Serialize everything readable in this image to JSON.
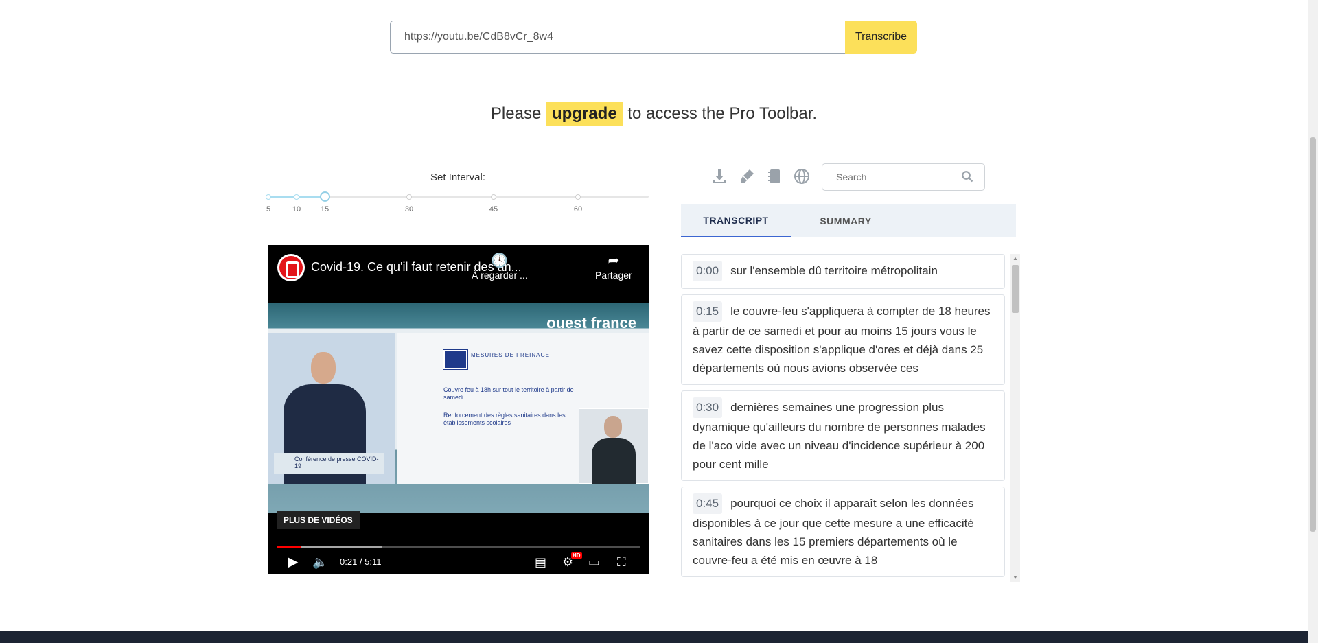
{
  "url_bar": {
    "value": "https://youtu.be/CdB8vCr_8w4",
    "button_label": "Transcribe"
  },
  "upgrade": {
    "before": "Please",
    "link": "upgrade",
    "after": "to access the Pro Toolbar."
  },
  "interval": {
    "label": "Set Interval:",
    "ticks": [
      "5",
      "10",
      "15",
      "30",
      "45",
      "60"
    ],
    "selected": 15
  },
  "video": {
    "title": "Covid-19. Ce qu'il faut retenir des an...",
    "watch_later_label": "À regarder ...",
    "share_label": "Partager",
    "brand_text": "ouest france",
    "podium_text": "Conférence de presse COVID-19",
    "slide_heading": "MESURES DE FREINAGE",
    "slide_bullet_1": "Couvre feu à 18h sur tout le territoire à partir de samedi",
    "slide_bullet_2": "Renforcement des règles sanitaires dans les établissements scolaires",
    "more_videos": "PLUS DE VIDÉOS",
    "current_time": "0:21",
    "duration": "5:11",
    "time_display": "0:21 / 5:11",
    "progress_played": 0.067,
    "progress_buffered": 0.29,
    "hd_badge": "HD"
  },
  "toolbar": {
    "icons": [
      "download-icon",
      "highlighter-icon",
      "notebook-icon",
      "globe-icon"
    ],
    "search_placeholder": "Search"
  },
  "tabs": [
    {
      "label": "TRANSCRIPT",
      "active": true
    },
    {
      "label": "SUMMARY",
      "active": false
    }
  ],
  "transcript": [
    {
      "time": "0:00",
      "text": "sur l'ensemble dû territoire métropolitain"
    },
    {
      "time": "0:15",
      "text": "le couvre-feu s'appliquera à compter de 18 heures à partir de ce samedi et pour au moins 15 jours vous le savez cette disposition s'applique d'ores et déjà dans 25 départements où nous avions observée ces"
    },
    {
      "time": "0:30",
      "text": "dernières semaines une progression plus dynamique qu'ailleurs du nombre de personnes malades de l'aco vide avec un niveau d'incidence supérieur à 200 pour cent mille"
    },
    {
      "time": "0:45",
      "text": "pourquoi ce choix il apparaît selon les données disponibles à ce jour que cette mesure a une efficacité sanitaires dans les 15 premiers départements où le couvre-feu a été mis en œuvre à 18"
    }
  ],
  "colors": {
    "accent_yellow": "#fce05a",
    "tab_active_border": "#3c66d1",
    "slider_fill": "#a9ddf0",
    "footer": "#1c2433"
  }
}
